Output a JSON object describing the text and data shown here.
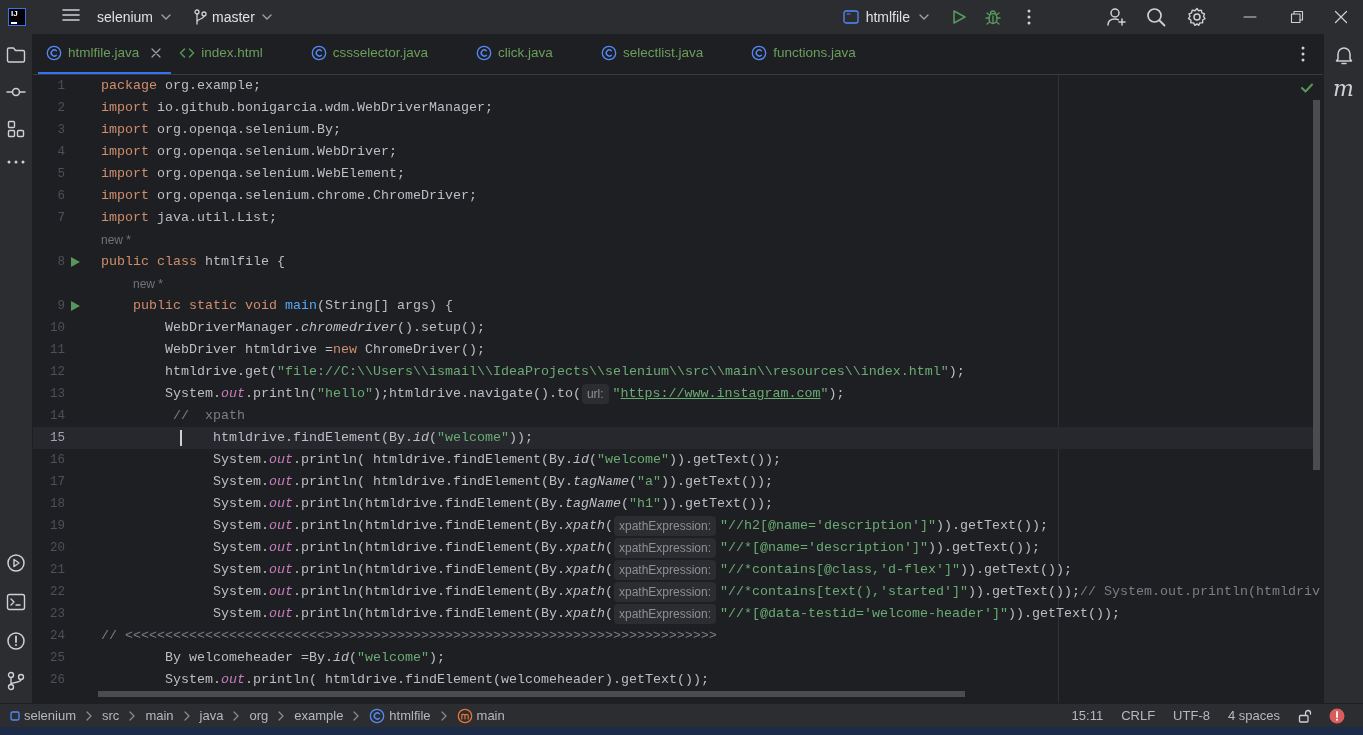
{
  "title_bar": {
    "logo": "IJ",
    "project": "selenium",
    "branch": "master",
    "run_config": "htmlfile"
  },
  "tabs": [
    {
      "label": "htmlfile.java",
      "kind": "java",
      "selected": true
    },
    {
      "label": "index.html",
      "kind": "html",
      "selected": false
    },
    {
      "label": "cssselector.java",
      "kind": "java",
      "selected": false
    },
    {
      "label": "click.java",
      "kind": "java",
      "selected": false
    },
    {
      "label": "selectlist.java",
      "kind": "java",
      "selected": false
    },
    {
      "label": "functions.java",
      "kind": "java",
      "selected": false
    }
  ],
  "editor": {
    "lines": [
      {
        "kind": "code",
        "number": "1",
        "run": false,
        "current": false,
        "tokens": [
          {
            "kind": "kw",
            "text": "package"
          },
          {
            "kind": "p",
            "text": " org.example;"
          }
        ]
      },
      {
        "kind": "code",
        "number": "2",
        "run": false,
        "current": false,
        "tokens": [
          {
            "kind": "kw",
            "text": "import"
          },
          {
            "kind": "p",
            "text": " io.github.bonigarcia.wdm.WebDriverManager;"
          }
        ]
      },
      {
        "kind": "code",
        "number": "3",
        "run": false,
        "current": false,
        "tokens": [
          {
            "kind": "kw",
            "text": "import"
          },
          {
            "kind": "p",
            "text": " org.openqa.selenium.By;"
          }
        ]
      },
      {
        "kind": "code",
        "number": "4",
        "run": false,
        "current": false,
        "tokens": [
          {
            "kind": "kw",
            "text": "import"
          },
          {
            "kind": "p",
            "text": " org.openqa.selenium.WebDriver;"
          }
        ]
      },
      {
        "kind": "code",
        "number": "5",
        "run": false,
        "current": false,
        "tokens": [
          {
            "kind": "kw",
            "text": "import"
          },
          {
            "kind": "p",
            "text": " org.openqa.selenium.WebElement;"
          }
        ]
      },
      {
        "kind": "code",
        "number": "6",
        "run": false,
        "current": false,
        "tokens": [
          {
            "kind": "kw",
            "text": "import"
          },
          {
            "kind": "p",
            "text": " org.openqa.selenium.chrome.ChromeDriver;"
          }
        ]
      },
      {
        "kind": "code",
        "number": "7",
        "run": false,
        "current": false,
        "tokens": [
          {
            "kind": "kw",
            "text": "import"
          },
          {
            "kind": "p",
            "text": " java.util.List;"
          }
        ]
      },
      {
        "kind": "annotation",
        "text": "new *"
      },
      {
        "kind": "code",
        "number": "8",
        "run": true,
        "current": false,
        "tokens": [
          {
            "kind": "kw",
            "text": "public class"
          },
          {
            "kind": "p",
            "text": " htmlfile {"
          }
        ]
      },
      {
        "kind": "annotation",
        "text": "    new *"
      },
      {
        "kind": "code",
        "number": "9",
        "run": true,
        "current": false,
        "tokens": [
          {
            "kind": "kw",
            "text": "    public static void"
          },
          {
            "kind": "decl",
            "text": " main"
          },
          {
            "kind": "p",
            "text": "(String[] args) {"
          }
        ]
      },
      {
        "kind": "code",
        "number": "10",
        "run": false,
        "current": false,
        "tokens": [
          {
            "kind": "p",
            "text": "        WebDriverManager."
          },
          {
            "kind": "static",
            "text": "chromedriver"
          },
          {
            "kind": "p",
            "text": "().setup();"
          }
        ]
      },
      {
        "kind": "code",
        "number": "11",
        "run": false,
        "current": false,
        "tokens": [
          {
            "kind": "p",
            "text": "        WebDriver htmldrive ="
          },
          {
            "kind": "kw",
            "text": "new"
          },
          {
            "kind": "p",
            "text": " ChromeDriver();"
          }
        ]
      },
      {
        "kind": "code",
        "number": "12",
        "run": false,
        "current": false,
        "tokens": [
          {
            "kind": "p",
            "text": "        htmldrive.get("
          },
          {
            "kind": "str",
            "text": "\"file://C:\\\\Users\\\\ismail\\\\IdeaProjects\\\\selenium\\\\src\\\\main\\\\resources\\\\index.html\""
          },
          {
            "kind": "p",
            "text": ");"
          }
        ]
      },
      {
        "kind": "code",
        "number": "13",
        "run": false,
        "current": false,
        "tokens": [
          {
            "kind": "p",
            "text": "        System."
          },
          {
            "kind": "field",
            "text": "out"
          },
          {
            "kind": "p",
            "text": ".println("
          },
          {
            "kind": "str",
            "text": "\"hello\""
          },
          {
            "kind": "p",
            "text": ");htmldrive.navigate().to("
          },
          {
            "kind": "hint",
            "text": "url:"
          },
          {
            "kind": "str",
            "text": "\""
          },
          {
            "kind": "link",
            "text": "https://www.instagram.com"
          },
          {
            "kind": "str",
            "text": "\""
          },
          {
            "kind": "p",
            "text": ");"
          }
        ]
      },
      {
        "kind": "code",
        "number": "14",
        "run": false,
        "current": false,
        "tokens": [
          {
            "kind": "comment",
            "text": "         //  xpath"
          }
        ]
      },
      {
        "kind": "code",
        "number": "15",
        "run": false,
        "current": true,
        "tokens": [
          {
            "kind": "p",
            "text": "              htmldrive.findElement(By."
          },
          {
            "kind": "static",
            "text": "id"
          },
          {
            "kind": "p",
            "text": "("
          },
          {
            "kind": "str",
            "text": "\"welcome\""
          },
          {
            "kind": "p",
            "text": "));"
          }
        ]
      },
      {
        "kind": "code",
        "number": "16",
        "run": false,
        "current": false,
        "tokens": [
          {
            "kind": "p",
            "text": "              System."
          },
          {
            "kind": "field",
            "text": "out"
          },
          {
            "kind": "p",
            "text": ".println( htmldrive.findElement(By."
          },
          {
            "kind": "static",
            "text": "id"
          },
          {
            "kind": "p",
            "text": "("
          },
          {
            "kind": "str",
            "text": "\"welcome\""
          },
          {
            "kind": "p",
            "text": ")).getText());"
          }
        ]
      },
      {
        "kind": "code",
        "number": "17",
        "run": false,
        "current": false,
        "tokens": [
          {
            "kind": "p",
            "text": "              System."
          },
          {
            "kind": "field",
            "text": "out"
          },
          {
            "kind": "p",
            "text": ".println( htmldrive.findElement(By."
          },
          {
            "kind": "static",
            "text": "tagName"
          },
          {
            "kind": "p",
            "text": "("
          },
          {
            "kind": "str",
            "text": "\"a\""
          },
          {
            "kind": "p",
            "text": ")).getText());"
          }
        ]
      },
      {
        "kind": "code",
        "number": "18",
        "run": false,
        "current": false,
        "tokens": [
          {
            "kind": "p",
            "text": "              System."
          },
          {
            "kind": "field",
            "text": "out"
          },
          {
            "kind": "p",
            "text": ".println(htmldrive.findElement(By."
          },
          {
            "kind": "static",
            "text": "tagName"
          },
          {
            "kind": "p",
            "text": "("
          },
          {
            "kind": "str",
            "text": "\"h1\""
          },
          {
            "kind": "p",
            "text": ")).getText());"
          }
        ]
      },
      {
        "kind": "code",
        "number": "19",
        "run": false,
        "current": false,
        "tokens": [
          {
            "kind": "p",
            "text": "              System."
          },
          {
            "kind": "field",
            "text": "out"
          },
          {
            "kind": "p",
            "text": ".println(htmldrive.findElement(By."
          },
          {
            "kind": "static",
            "text": "xpath"
          },
          {
            "kind": "p",
            "text": "("
          },
          {
            "kind": "hint",
            "text": "xpathExpression:"
          },
          {
            "kind": "str",
            "text": "\"//h2[@name='description']\""
          },
          {
            "kind": "p",
            "text": ")).getText());"
          }
        ]
      },
      {
        "kind": "code",
        "number": "20",
        "run": false,
        "current": false,
        "tokens": [
          {
            "kind": "p",
            "text": "              System."
          },
          {
            "kind": "field",
            "text": "out"
          },
          {
            "kind": "p",
            "text": ".println(htmldrive.findElement(By."
          },
          {
            "kind": "static",
            "text": "xpath"
          },
          {
            "kind": "p",
            "text": "("
          },
          {
            "kind": "hint",
            "text": "xpathExpression:"
          },
          {
            "kind": "str",
            "text": "\"//*[@name='description']\""
          },
          {
            "kind": "p",
            "text": ")).getText());"
          }
        ]
      },
      {
        "kind": "code",
        "number": "21",
        "run": false,
        "current": false,
        "tokens": [
          {
            "kind": "p",
            "text": "              System."
          },
          {
            "kind": "field",
            "text": "out"
          },
          {
            "kind": "p",
            "text": ".println(htmldrive.findElement(By."
          },
          {
            "kind": "static",
            "text": "xpath"
          },
          {
            "kind": "p",
            "text": "("
          },
          {
            "kind": "hint",
            "text": "xpathExpression:"
          },
          {
            "kind": "str",
            "text": "\"//*contains[@class,'d-flex']\""
          },
          {
            "kind": "p",
            "text": ")).getText());"
          }
        ]
      },
      {
        "kind": "code",
        "number": "22",
        "run": false,
        "current": false,
        "tokens": [
          {
            "kind": "p",
            "text": "              System."
          },
          {
            "kind": "field",
            "text": "out"
          },
          {
            "kind": "p",
            "text": ".println(htmldrive.findElement(By."
          },
          {
            "kind": "static",
            "text": "xpath"
          },
          {
            "kind": "p",
            "text": "("
          },
          {
            "kind": "hint",
            "text": "xpathExpression:"
          },
          {
            "kind": "str",
            "text": "\"//*contains[text(),'started']\""
          },
          {
            "kind": "p",
            "text": ")).getText());"
          },
          {
            "kind": "comment",
            "text": "// System.out.println(htmldriv"
          }
        ]
      },
      {
        "kind": "code",
        "number": "23",
        "run": false,
        "current": false,
        "tokens": [
          {
            "kind": "p",
            "text": "              System."
          },
          {
            "kind": "field",
            "text": "out"
          },
          {
            "kind": "p",
            "text": ".println(htmldrive.findElement(By."
          },
          {
            "kind": "static",
            "text": "xpath"
          },
          {
            "kind": "p",
            "text": "("
          },
          {
            "kind": "hint",
            "text": "xpathExpression:"
          },
          {
            "kind": "str",
            "text": "\"//*[@data-testid='welcome-header']\""
          },
          {
            "kind": "p",
            "text": ")).getText());"
          }
        ]
      },
      {
        "kind": "code",
        "number": "24",
        "run": false,
        "current": false,
        "tokens": [
          {
            "kind": "comment",
            "text": "// <<<<<<<<<<<<<<<<<<<<<<<<<>>>>>>>>>>>>>>>>>>>>>>>>>>>>>>>>>>>>>>>>>>>>>>>>>"
          }
        ]
      },
      {
        "kind": "code",
        "number": "25",
        "run": false,
        "current": false,
        "tokens": [
          {
            "kind": "p",
            "text": "        By welcomeheader =By."
          },
          {
            "kind": "static",
            "text": "id"
          },
          {
            "kind": "p",
            "text": "("
          },
          {
            "kind": "str",
            "text": "\"welcome\""
          },
          {
            "kind": "p",
            "text": ");"
          }
        ]
      },
      {
        "kind": "code",
        "number": "26",
        "run": false,
        "current": false,
        "tokens": [
          {
            "kind": "p",
            "text": "        System."
          },
          {
            "kind": "field",
            "text": "out"
          },
          {
            "kind": "p",
            "text": ".println( htmldrive.findElement(welcomeheader).getText());"
          }
        ]
      }
    ]
  },
  "right_strip": {
    "maven": "m"
  },
  "breadcrumbs": [
    {
      "label": "selenium",
      "kind": "module"
    },
    {
      "label": "src",
      "kind": "folder"
    },
    {
      "label": "main",
      "kind": "folder"
    },
    {
      "label": "java",
      "kind": "folder"
    },
    {
      "label": "org",
      "kind": "folder"
    },
    {
      "label": "example",
      "kind": "folder"
    },
    {
      "label": "htmlfile",
      "kind": "class"
    },
    {
      "label": "main",
      "kind": "method"
    }
  ],
  "status": [
    "15:11",
    "CRLF",
    "UTF-8",
    "4 spaces"
  ]
}
